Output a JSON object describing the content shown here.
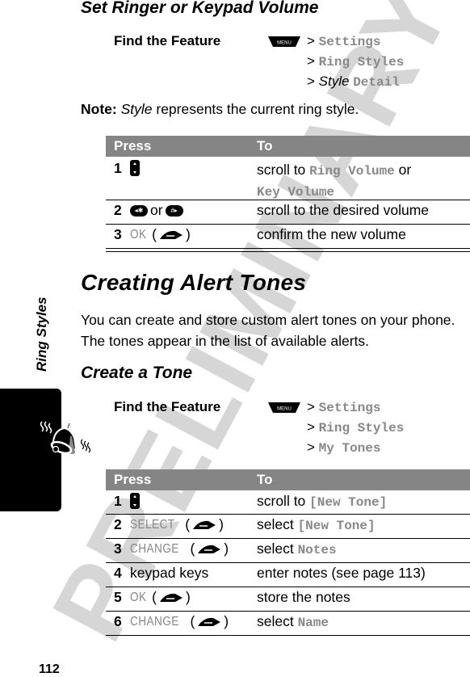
{
  "watermark": "PRELIMINARY",
  "side": {
    "section_label": "Ring Styles",
    "tab_icon": "ringing-bell-icon"
  },
  "page_number": "112",
  "section1": {
    "title": "Set Ringer or Keypad Volume",
    "find_feature_label": "Find the Feature",
    "menu_key_label": "MENU",
    "path": [
      {
        "prefix": ">",
        "italic": "",
        "mono": "Settings"
      },
      {
        "prefix": ">",
        "italic": "",
        "mono": "Ring Styles"
      },
      {
        "prefix": ">",
        "italic": "Style",
        "mono": "Detail"
      }
    ],
    "note_label": "Note:",
    "note_italic": "Style",
    "note_text": " represents the current ring style.",
    "table": {
      "headers": [
        "Press",
        "To"
      ],
      "rows": [
        {
          "num": "1",
          "press_icon": "nav-key-icon",
          "press_text": "",
          "to_text": "scroll to ",
          "to_mono": "Ring Volume",
          "to_text2": " or",
          "to_mono2": "Key Volume"
        },
        {
          "num": "2",
          "press_icon": "star-key-icon",
          "press_or": "or",
          "press_icon2": "pound-key-icon",
          "to_text": "scroll to the desired volume"
        },
        {
          "num": "3",
          "press_soft": "OK",
          "press_icon": "right-soft-key-icon",
          "to_text": "confirm the new volume"
        }
      ]
    }
  },
  "section2": {
    "title": "Creating Alert Tones",
    "body": "You can create and store custom alert tones on your phone. The tones appear in the list of available alerts.",
    "subsection": {
      "title": "Create a Tone",
      "find_feature_label": "Find the Feature",
      "menu_key_label": "MENU",
      "path": [
        {
          "prefix": ">",
          "mono": "Settings"
        },
        {
          "prefix": ">",
          "mono": "Ring Styles"
        },
        {
          "prefix": ">",
          "mono": "My Tones"
        }
      ],
      "table": {
        "headers": [
          "Press",
          "To"
        ],
        "rows": [
          {
            "num": "1",
            "press_icon": "nav-key-icon",
            "to_text": "scroll to ",
            "to_mono": "[New Tone]"
          },
          {
            "num": "2",
            "press_soft": "SELECT",
            "to_text": "select ",
            "to_mono": "[New Tone]"
          },
          {
            "num": "3",
            "press_soft": "CHANGE",
            "to_text": "select ",
            "to_mono": "Notes"
          },
          {
            "num": "4",
            "press_text": "keypad keys",
            "to_text": "enter notes (see page 113)"
          },
          {
            "num": "5",
            "press_soft": "OK",
            "to_text": "store the notes"
          },
          {
            "num": "6",
            "press_soft": "CHANGE",
            "to_text": "select ",
            "to_mono": "Name"
          }
        ]
      }
    }
  }
}
